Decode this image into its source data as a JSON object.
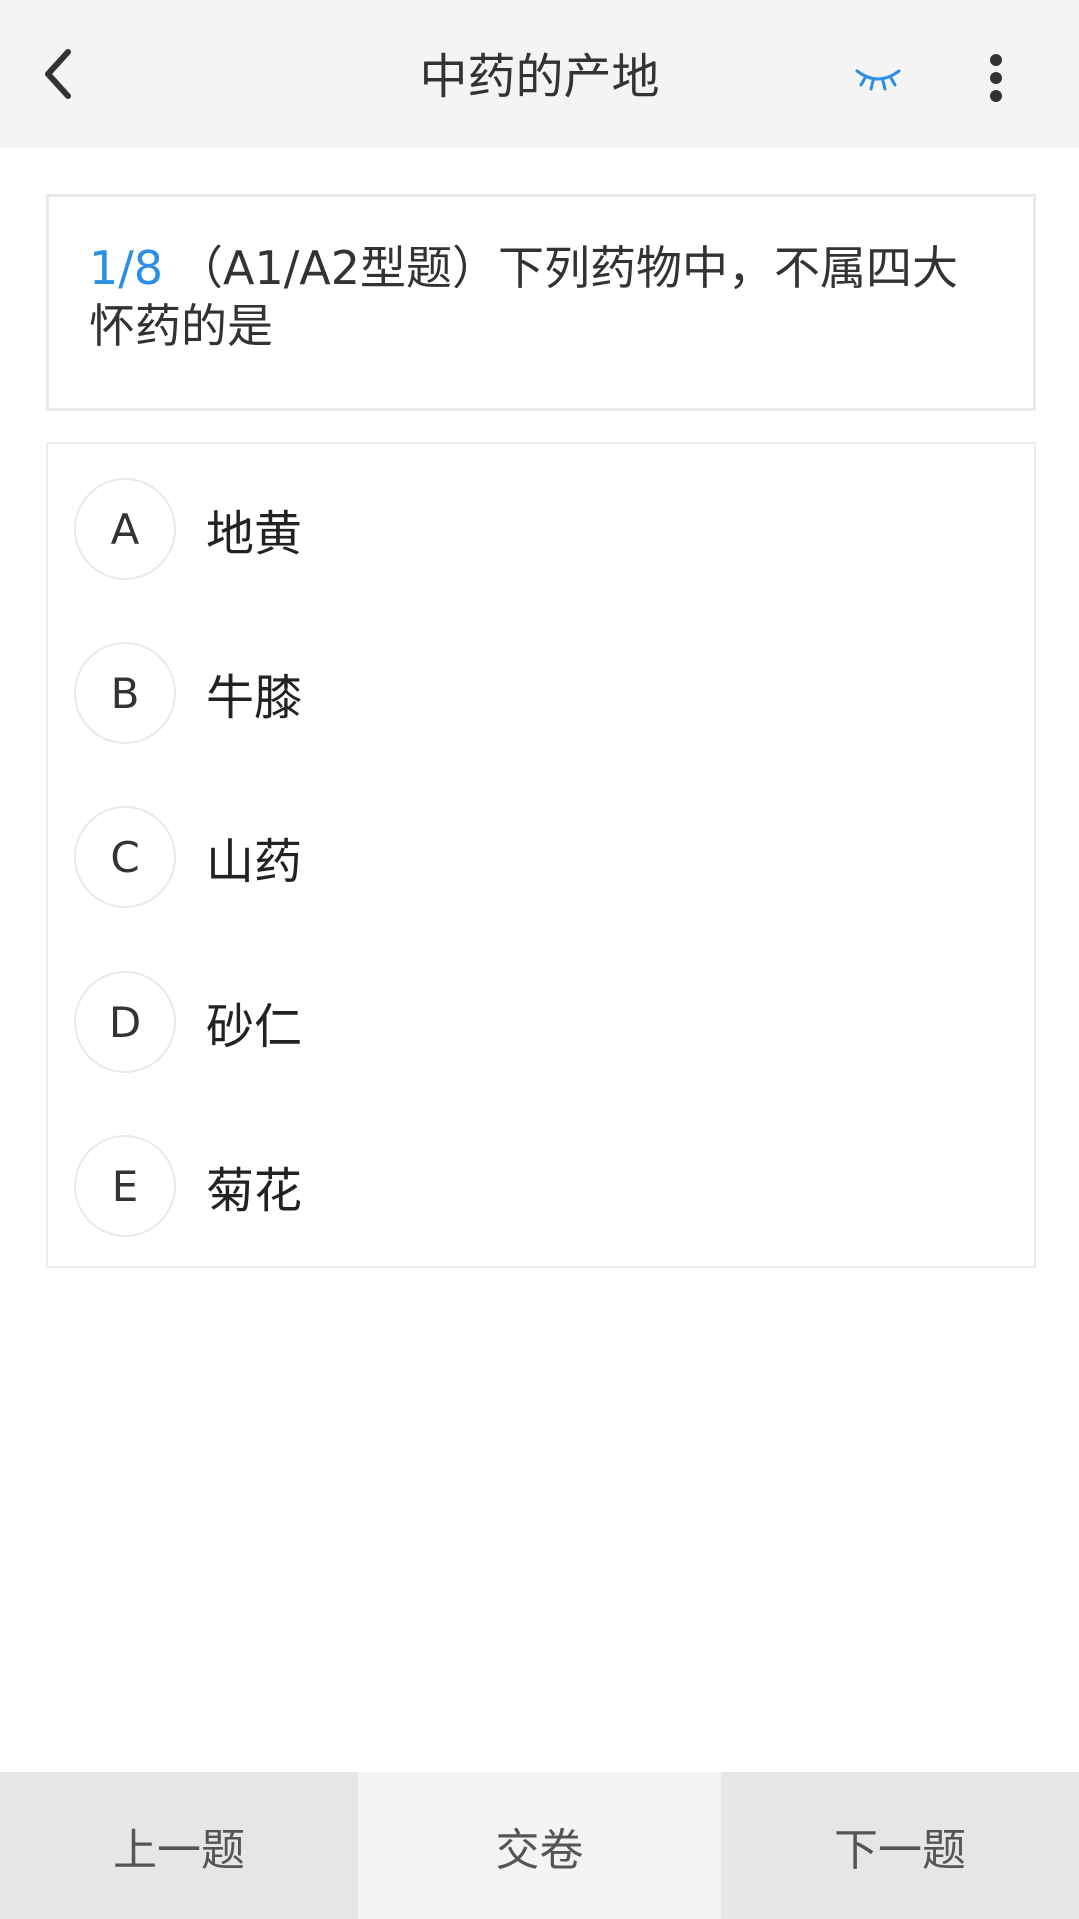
{
  "header": {
    "title": "中药的产地",
    "icons": {
      "back": "chevron-left-icon",
      "eye": "eye-closed-icon",
      "more": "more-vertical-icon"
    }
  },
  "question": {
    "number": "1/8",
    "text": "（A1/A2型题）下列药物中，不属四大怀药的是"
  },
  "options": [
    {
      "letter": "A",
      "text": "地黄"
    },
    {
      "letter": "B",
      "text": "牛膝"
    },
    {
      "letter": "C",
      "text": "山药"
    },
    {
      "letter": "D",
      "text": "砂仁"
    },
    {
      "letter": "E",
      "text": "菊花"
    }
  ],
  "bottom": {
    "prev_label": "上一题",
    "submit_label": "交卷",
    "next_label": "下一题"
  },
  "colors": {
    "accent": "#2b8fe6",
    "header_bg": "#f4f4f4",
    "bottom_side_bg": "#e6e6e6"
  }
}
